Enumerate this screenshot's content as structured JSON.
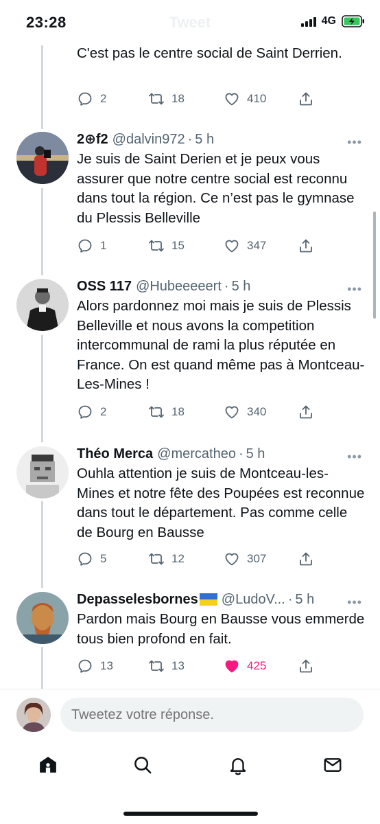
{
  "status_bar": {
    "time": "23:28",
    "ghost_title": "Tweet",
    "network": "4G"
  },
  "top_tweet": {
    "text": "C'est pas le centre social de Saint Derrien.",
    "replies": "2",
    "retweets": "18",
    "likes": "410"
  },
  "tweets": [
    {
      "name": "2⊕f2",
      "handle": "@dalvin972",
      "time": "5 h",
      "text": "Je suis de Saint Derien et je peux vous assurer que notre centre social est reconnu dans tout la région. Ce n’est pas le gymnase du Plessis Belleville",
      "replies": "1",
      "retweets": "15",
      "likes": "347",
      "liked": false
    },
    {
      "name": "OSS 117",
      "handle": "@Hubeeeeert",
      "time": "5 h",
      "text": "Alors pardonnez moi mais je suis de Plessis Belleville et nous avons la competition intercommunal de rami la plus réputée en France. On est quand même pas à Montceau-Les-Mines !",
      "replies": "2",
      "retweets": "18",
      "likes": "340",
      "liked": false
    },
    {
      "name": "Théo Merca",
      "handle": "@mercatheo",
      "time": "5 h",
      "text": "Ouhla attention je suis de Montceau-les-Mines et notre fête des Poupées est reconnue dans tout le département. Pas comme celle de Bourg en Bausse",
      "replies": "5",
      "retweets": "12",
      "likes": "307",
      "liked": false
    },
    {
      "name": "Depasselesbornes",
      "handle": "@LudoV...",
      "time": "5 h",
      "text": "Pardon mais Bourg en Bausse vous emmerde tous bien profond en fait.",
      "replies": "13",
      "retweets": "13",
      "likes": "425",
      "liked": true
    }
  ],
  "reply": {
    "placeholder": "Tweetez votre réponse."
  },
  "tab_bar": {
    "icons": [
      "home-icon",
      "search-icon",
      "notifications-bell-icon",
      "messages-envelope-icon"
    ]
  },
  "colors": {
    "text": "#0f1419",
    "secondary": "#536471",
    "like": "#f91880",
    "thread_line": "#cfd9de",
    "input_bg": "#eff3f4"
  }
}
